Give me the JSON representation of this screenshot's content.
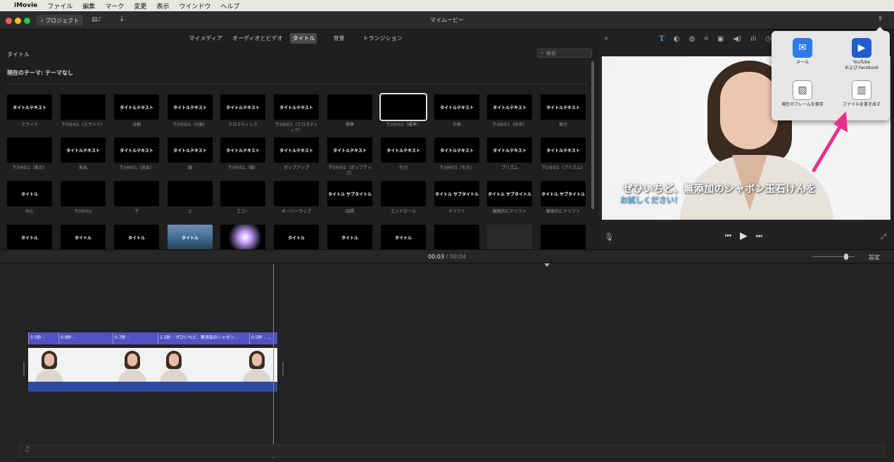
{
  "menubar": {
    "app": "iMovie",
    "items": [
      "ファイル",
      "編集",
      "マーク",
      "変更",
      "表示",
      "ウインドウ",
      "ヘルプ"
    ]
  },
  "toolbar": {
    "back_label": "プロジェクト",
    "window_title": "マイムービー"
  },
  "browser": {
    "tabs": [
      {
        "label": "マイメディア",
        "active": false
      },
      {
        "label": "オーディオとビデオ",
        "active": false
      },
      {
        "label": "タイトル",
        "active": true
      },
      {
        "label": "背景",
        "active": false
      },
      {
        "label": "トランジション",
        "active": false
      }
    ],
    "header": "タイトル",
    "search_placeholder": "検索",
    "theme_label": "現在のテーマ: テーマなし",
    "tiles": [
      {
        "label": "スライド",
        "thumb": "タイトルテキスト"
      },
      {
        "label": "下3分の1（スライド）",
        "thumb": ""
      },
      {
        "label": "分割",
        "thumb": "タイトルテキスト"
      },
      {
        "label": "下3分の1（分割）",
        "thumb": "タイトルテキスト"
      },
      {
        "label": "クロマティック",
        "thumb": "タイトルテキスト"
      },
      {
        "label": "下3分の1（クロマティック）",
        "thumb": "タイトルテキスト"
      },
      {
        "label": "標準",
        "thumb": ""
      },
      {
        "label": "下3分の1（標準）",
        "thumb": ""
      },
      {
        "label": "中央",
        "thumb": "タイトルテキスト"
      },
      {
        "label": "下3分の1（中央）",
        "thumb": "タイトルテキスト"
      },
      {
        "label": "表示",
        "thumb": "タイトルテキスト"
      },
      {
        "label": "下3分の1（表示）",
        "thumb": ""
      },
      {
        "label": "見出",
        "thumb": "タイトルテキスト"
      },
      {
        "label": "下3分の1（見出）",
        "thumb": "タイトルテキスト"
      },
      {
        "label": "線",
        "thumb": "タイトルテキスト"
      },
      {
        "label": "下3分の1（線）",
        "thumb": "タイトルテキスト"
      },
      {
        "label": "ポップアップ",
        "thumb": "タイトルテキスト"
      },
      {
        "label": "下3分の1（ポップアップ）",
        "thumb": "タイトルテキスト"
      },
      {
        "label": "引力",
        "thumb": "タイトルテキスト"
      },
      {
        "label": "下3分の1（引力）",
        "thumb": "タイトルテキスト"
      },
      {
        "label": "プリズム",
        "thumb": "タイトルテキスト"
      },
      {
        "label": "下3分の1（プリズム）",
        "thumb": "タイトルテキスト"
      },
      {
        "label": "中心",
        "thumb": "タイトル"
      },
      {
        "label": "下3分の1",
        "thumb": ""
      },
      {
        "label": "下",
        "thumb": ""
      },
      {
        "label": "上",
        "thumb": ""
      },
      {
        "label": "エコー",
        "thumb": ""
      },
      {
        "label": "オーバーラップ",
        "thumb": ""
      },
      {
        "label": "四隅",
        "thumb": "タイトル サブタイトル"
      },
      {
        "label": "エンドロール",
        "thumb": ""
      },
      {
        "label": "ドリフト",
        "thumb": "タイトル サブタイトル"
      },
      {
        "label": "観客的にドリフト",
        "thumb": "タイトル サブタイトル"
      },
      {
        "label": "観客的にドリフト",
        "thumb": "タイトル サブタイトル"
      },
      {
        "label": "",
        "thumb": "タイトル"
      },
      {
        "label": "",
        "thumb": "タイトル"
      },
      {
        "label": "",
        "thumb": "タイトル"
      },
      {
        "label": "",
        "thumb": "タイトル"
      },
      {
        "label": "",
        "thumb": ""
      },
      {
        "label": "",
        "thumb": "タイトル"
      },
      {
        "label": "",
        "thumb": "タイトル"
      },
      {
        "label": "",
        "thumb": "タイトル"
      },
      {
        "label": "",
        "thumb": ""
      },
      {
        "label": "",
        "thumb": ""
      },
      {
        "label": "",
        "thumb": ""
      }
    ]
  },
  "viewer": {
    "caption_line1": "ぜひいちど、無添加のシャボン玉石けんを",
    "caption_line2": "お試しください！"
  },
  "share": {
    "items": [
      {
        "label": "メール",
        "icon": "mail-icon"
      },
      {
        "label": "YouTube\nおよび Facebook",
        "icon": "youtube-icon"
      },
      {
        "label": "現在のフレームを保存",
        "icon": "image-icon"
      },
      {
        "label": "ファイルを書き出す",
        "icon": "film-icon"
      }
    ]
  },
  "timeline": {
    "current_time": "00:03",
    "separator": "/",
    "total_time": "00:04",
    "settings_label": "設定",
    "title_segments": [
      "0.5秒 – ",
      "0.9秒 – ",
      "0.7秒 – ",
      "1.5秒 – ぜひいちど、無添加のシャボン…",
      "0.5秒 – …"
    ]
  },
  "colors": {
    "title_track": "#5451c4",
    "audio_track": "#2c4aa1",
    "accent_arrow": "#e8308a",
    "caption_blue": "#5fb3e6"
  }
}
